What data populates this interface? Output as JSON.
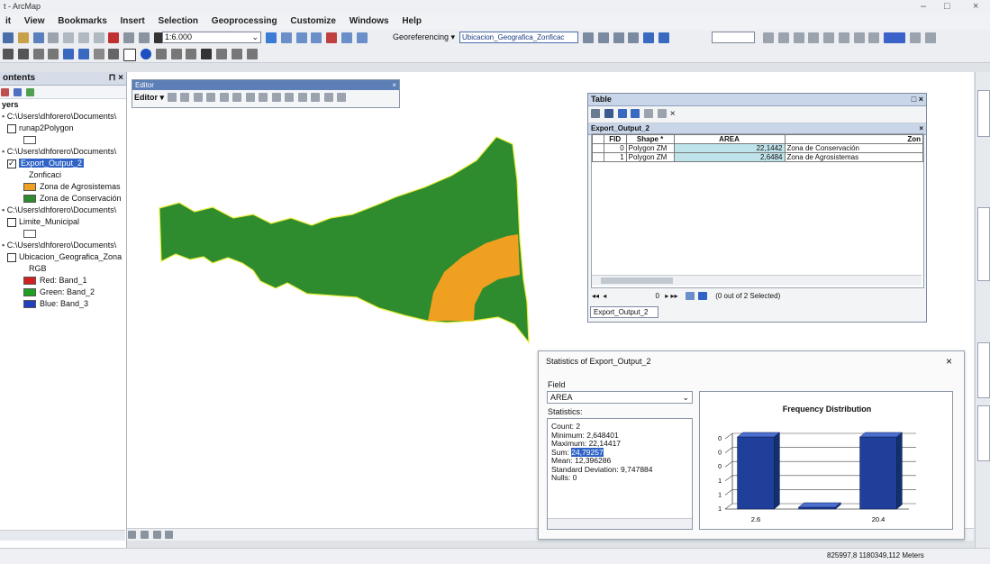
{
  "app": {
    "title": "t - ArcMap",
    "window_controls": [
      "–",
      "□",
      "×"
    ]
  },
  "menu": [
    "it",
    "View",
    "Bookmarks",
    "Insert",
    "Selection",
    "Geoprocessing",
    "Customize",
    "Windows",
    "Help"
  ],
  "toolbar": {
    "scale_value": "1:6.000",
    "georef_label": "Georeferencing ▾",
    "georef_layer": "Ubicacion_Geografica_Zonficac"
  },
  "toc": {
    "title": "ontents",
    "pin": "⊓ ×",
    "layers_label": "yers",
    "rows": [
      {
        "text": "C:\\Users\\dhforero\\Documents\\"
      },
      {
        "text": "runap2Polygon"
      },
      {
        "text": "C:\\Users\\dhforero\\Documents\\"
      },
      {
        "text": "Export_Output_2"
      },
      {
        "text": "Zonficaci"
      },
      {
        "text": "Zona de Agrosistemas"
      },
      {
        "text": "Zona de Conservación"
      },
      {
        "text": "C:\\Users\\dhforero\\Documents\\"
      },
      {
        "text": "Limite_Municipal"
      },
      {
        "text": "C:\\Users\\dhforero\\Documents\\"
      },
      {
        "text": "Ubicacion_Geografica_Zona"
      },
      {
        "text": "RGB"
      },
      {
        "text": "Red:  Band_1"
      },
      {
        "text": "Green: Band_2"
      },
      {
        "text": "Blue:  Band_3"
      }
    ]
  },
  "editor": {
    "title": "Editor",
    "menu": "Editor ▾"
  },
  "table_window": {
    "title": "Table",
    "tab_name": "Export_Output_2",
    "columns": [
      "FID",
      "Shape *",
      "AREA",
      "Zon"
    ],
    "rows": [
      {
        "fid": "0",
        "shape": "Polygon ZM",
        "area": "22,1442",
        "zona": "Zona de Conservación"
      },
      {
        "fid": "1",
        "shape": "Polygon ZM",
        "area": "2,6484",
        "zona": "Zona de Agrosistemas"
      }
    ],
    "nav_pos": "0",
    "selected_text": "(0 out of 2 Selected)",
    "bottom_tab": "Export_Output_2"
  },
  "stats_window": {
    "title": "Statistics of Export_Output_2",
    "field_label": "Field",
    "field_value": "AREA",
    "stats_label": "Statistics:",
    "lines": [
      {
        "k": "Count:",
        "v": "2"
      },
      {
        "k": "Minimum:",
        "v": "2,648401"
      },
      {
        "k": "Maximum:",
        "v": "22,14417"
      },
      {
        "k": "Sum:",
        "v": "24,79257"
      },
      {
        "k": "Mean:",
        "v": "12,396286"
      },
      {
        "k": "Standard Deviation:",
        "v": "9,747884"
      },
      {
        "k": "Nulls:",
        "v": "0"
      }
    ]
  },
  "chart_data": {
    "type": "bar",
    "title": "Frequency Distribution",
    "categories": [
      "2.6",
      "",
      "20.4"
    ],
    "values": [
      1,
      0,
      1
    ],
    "ylim": [
      0,
      1
    ],
    "yticks": [
      "0",
      "0",
      "0",
      "1",
      "1",
      "1"
    ],
    "xlabels": [
      "2.6",
      "20.4"
    ],
    "bar_color": "#1f3f9a"
  },
  "status": {
    "coords": "825997,8  1180349,112 Meters"
  },
  "colors": {
    "conservacion": "#2e8b2e",
    "agrosistemas": "#f0a020",
    "selected_row": "#bfe3ea"
  }
}
